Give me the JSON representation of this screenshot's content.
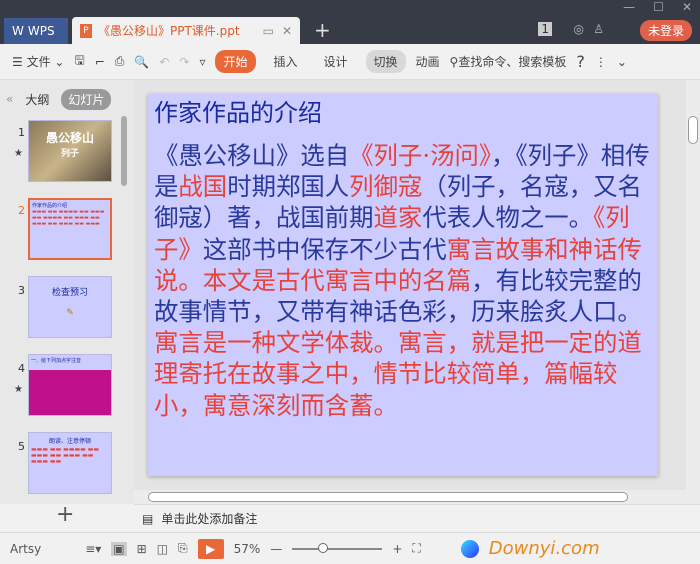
{
  "titlebar": {
    "wps_tab": "WPS",
    "doc_tab": "《愚公移山》PPT课件.ppt",
    "login": "未登录",
    "page_badge": "1"
  },
  "toolbar": {
    "file": "文件",
    "tabs": [
      "开始",
      "插入",
      "设计",
      "切换",
      "动画"
    ],
    "search": "查找命令、搜索模板",
    "help": "?"
  },
  "leftpane": {
    "outline": "大纲",
    "slides": "幻灯片",
    "thumbs": [
      {
        "num": "1",
        "title": "愚公移山",
        "sub": "列子"
      },
      {
        "num": "2",
        "title": "作家作品的介绍"
      },
      {
        "num": "3",
        "title": "检查预习"
      },
      {
        "num": "4",
        "title": "一、给下列加点字注音"
      },
      {
        "num": "5",
        "title": "朗读、注意停顿"
      }
    ]
  },
  "slide": {
    "title": "作家作品的介绍",
    "p1": [
      [
        "《愚公移山》选自",
        "b"
      ],
      [
        "《列子·汤问》",
        "r"
      ],
      [
        "，《列子》相传是",
        "b"
      ],
      [
        "战国",
        "r"
      ],
      [
        "时期郑国人",
        "b"
      ],
      [
        "列御寇",
        "r"
      ],
      [
        "（列子，名寇，又名御寇）著，战国前期",
        "b"
      ],
      [
        "道家",
        "r"
      ],
      [
        "代表人物之一。",
        "b"
      ],
      [
        "《列子》",
        "r"
      ],
      [
        "这部书中保存不少古代",
        "b"
      ],
      [
        "寓言故事和神话传说。本文是古代寓言中的名篇",
        "r"
      ],
      [
        "，有比较完整的故事情节，又带有神话色彩，历来脍炙人口。",
        "b"
      ]
    ],
    "p2": "寓言是一种文学体裁。寓言，就是把一定的道理寄托在故事之中，情节比较简单，篇幅较小，寓意深刻而含蓄。"
  },
  "notes": {
    "placeholder": "单击此处添加备注"
  },
  "status": {
    "theme": "Artsy",
    "zoom": "57%",
    "watermark": "Downyi.com"
  },
  "colors": {
    "accent": "#e8683a",
    "slide_bg": "#ccccff",
    "text_blue": "#2a3a9c",
    "text_red": "#e8423c"
  }
}
